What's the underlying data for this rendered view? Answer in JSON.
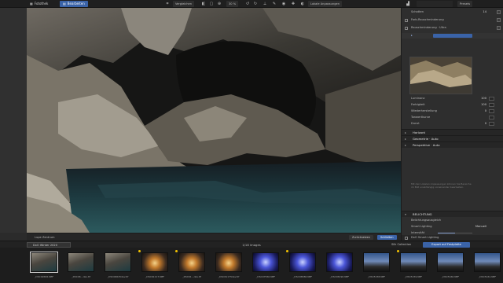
{
  "topbar": {
    "tabs": [
      {
        "label": "Fotothek",
        "active": false
      },
      {
        "label": "Bearbeiten",
        "active": true
      }
    ],
    "compare_label": "Vergleichen",
    "zoom_text": "30 %",
    "local_adjust_label": "Lokale Anpassungen",
    "presets_label": "Presets"
  },
  "panel": {
    "rows": [
      {
        "label": "Schatten",
        "value": "14"
      },
      {
        "label": "Farb-Rauschminderung",
        "value": ""
      },
      {
        "label": "Rauschminderung · Ultra",
        "value": ""
      },
      {
        "label": "Luminanz",
        "value": "100"
      },
      {
        "label": "Farbigkeit",
        "value": "100"
      },
      {
        "label": "Wiederherstellung",
        "value": "0"
      },
      {
        "label": "Tonwertkurve",
        "value": ""
      },
      {
        "label": "Dunst",
        "value": "0"
      }
    ],
    "sections": [
      {
        "label": "Horizont"
      },
      {
        "label": "Geometrie · Auto"
      },
      {
        "label": "Perspektive · Auto"
      }
    ],
    "hint": "Mit den Lokalen Anpassungen können Sie Bereiche im Bild unabhängig voneinander bearbeiten.",
    "lighting_header": "BELICHTUNG",
    "lighting_rows": [
      {
        "label": "Belichtungsausgleich",
        "value": ""
      },
      {
        "label": "Smart Lighting",
        "value": "Manuell"
      },
      {
        "label": "Intensität",
        "value": ""
      }
    ],
    "smart_lighting_label": "DxO Smart Lighting"
  },
  "viewer_bar": {
    "left_label": "Lupe Zentrum",
    "reset_label": "Zurücksetzen",
    "close_label": "Schließen"
  },
  "filmstrip": {
    "folder": "DxO Winter 2020",
    "count_text": "1/18 images",
    "collection_label": "Silk Collection",
    "export_label": "Export auf Festplatte",
    "thumbs": [
      {
        "name": "_DSC02682.NEF",
        "kind": "cave",
        "starred": false,
        "selected": true
      },
      {
        "name": "_DSC06...dev.tif",
        "kind": "cave",
        "starred": false,
        "selected": false
      },
      {
        "name": "_DSC06625dev.tif",
        "kind": "cave",
        "starred": false,
        "selected": false
      },
      {
        "name": "_DSC61117.NEF",
        "kind": "warm",
        "starred": true,
        "selected": false
      },
      {
        "name": "_DSC61...dev.tif",
        "kind": "warm",
        "starred": true,
        "selected": false
      },
      {
        "name": "_DSC61175dev.tif",
        "kind": "warm",
        "starred": false,
        "selected": false
      },
      {
        "name": "_DSC07560.NEF",
        "kind": "blue",
        "starred": false,
        "selected": false
      },
      {
        "name": "_DSC06586.NEF",
        "kind": "blue",
        "starred": true,
        "selected": false
      },
      {
        "name": "_DSC06190.NEF",
        "kind": "blue",
        "starred": false,
        "selected": false
      },
      {
        "name": "_DSC5158.NEF",
        "kind": "city",
        "starred": false,
        "selected": false
      },
      {
        "name": "_DSC5159.NEF",
        "kind": "city",
        "starred": true,
        "selected": false
      },
      {
        "name": "_DSC5160.NEF",
        "kind": "city",
        "starred": false,
        "selected": false
      },
      {
        "name": "_DSC5161.NEF",
        "kind": "city",
        "starred": false,
        "selected": false
      }
    ]
  }
}
